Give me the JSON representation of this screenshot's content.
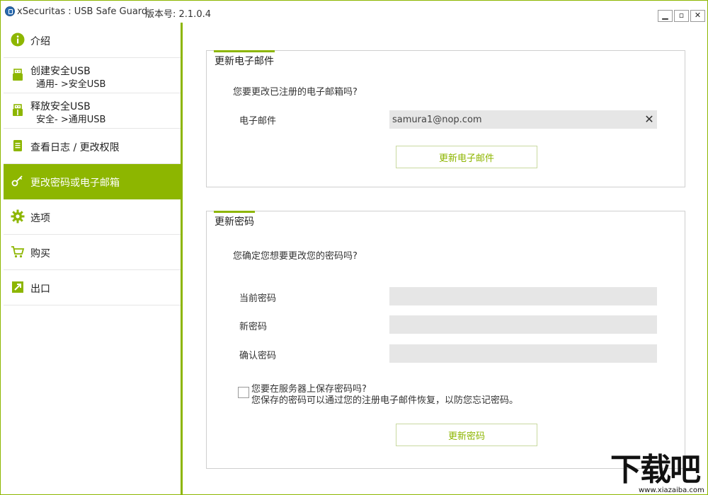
{
  "window": {
    "title": "xSecuritas : USB Safe Guard",
    "version": "版本号: 2.1.0.4",
    "controls": {
      "minimize": "▁",
      "maximize": "▫",
      "close": "✕"
    }
  },
  "sidebar": {
    "items": [
      {
        "label": "介绍",
        "icon": "info-icon"
      },
      {
        "label": "创建安全USB",
        "sub": "通用- >安全USB",
        "icon": "usb-icon"
      },
      {
        "label": "释放安全USB",
        "sub": "安全- >通用USB",
        "icon": "usb-open-icon"
      },
      {
        "label": "查看日志 / 更改权限",
        "icon": "scroll-icon"
      },
      {
        "label": "更改密码或电子邮箱",
        "icon": "key-icon",
        "active": true
      },
      {
        "label": "选项",
        "icon": "gear-icon"
      },
      {
        "label": "购买",
        "icon": "cart-icon"
      },
      {
        "label": "出口",
        "icon": "exit-icon"
      }
    ]
  },
  "email_section": {
    "title": "更新电子邮件",
    "question": "您要更改已注册的电子邮箱吗?",
    "field_label": "电子邮件",
    "field_value": "samura1@nop.com",
    "button": "更新电子邮件"
  },
  "password_section": {
    "title": "更新密码",
    "question": "您确定您想要更改您的密码吗?",
    "current_label": "当前密码",
    "new_label": "新密码",
    "confirm_label": "确认密码",
    "save_question": "您要在服务器上保存密码吗?",
    "save_note": "您保存的密码可以通过您的注册电子邮件恢复，以防您忘记密码。",
    "save_checked": false,
    "button": "更新密码"
  },
  "watermark": {
    "main": "下载吧",
    "url": "www.xiazaiba.com"
  },
  "colors": {
    "accent": "#8db600",
    "input_bg": "#e6e6e6",
    "border": "#cfcfcf"
  }
}
